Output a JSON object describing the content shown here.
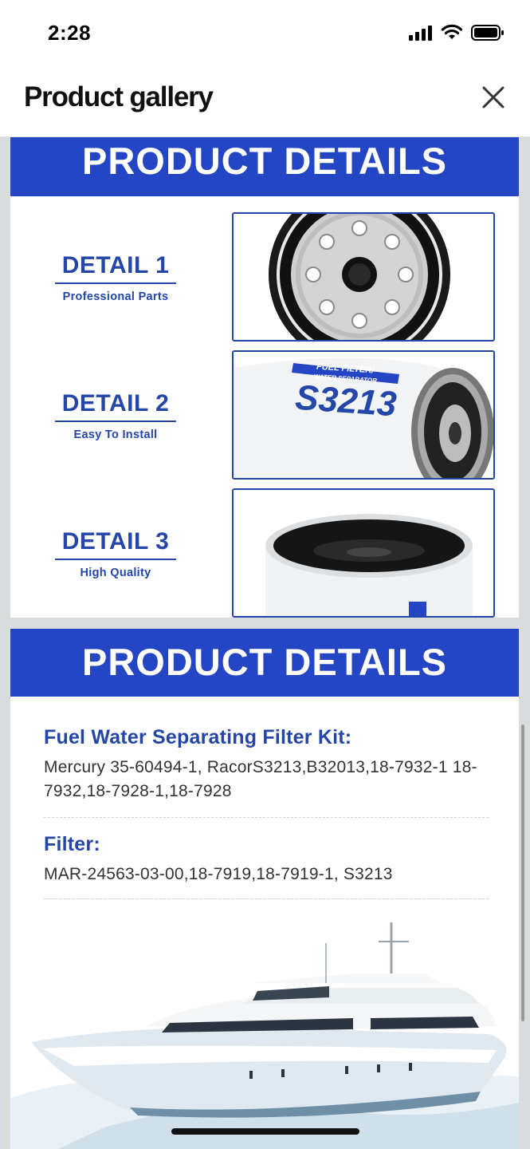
{
  "status_bar": {
    "time": "2:28",
    "icons": [
      "cellular-signal-icon",
      "wifi-icon",
      "battery-icon"
    ]
  },
  "header": {
    "title": "Product gallery",
    "close_icon": "close-icon"
  },
  "gallery": {
    "panel1": {
      "banner": "PRODUCT DETAILS",
      "details": [
        {
          "title": "DETAIL 1",
          "subtitle": "Professional Parts",
          "image": "filter-top-view-image"
        },
        {
          "title": "DETAIL 2",
          "subtitle": "Easy To Install",
          "image": "filter-label-image",
          "label_top": "FUEL FILTER/",
          "label_mid": "WATER SEPARATOR",
          "label_model": "S3213"
        },
        {
          "title": "DETAIL 3",
          "subtitle": "High Quality",
          "image": "filter-base-image"
        }
      ]
    },
    "panel2": {
      "banner": "PRODUCT DETAILS",
      "sections": [
        {
          "heading": "Fuel Water Separating Filter Kit:",
          "body": "Mercury 35-60494-1, RacorS3213,B32013,18-7932-1 18-7932,18-7928-1,18-7928"
        },
        {
          "heading": "Filter:",
          "body": "MAR-24563-03-00,18-7919,18-7919-1, S3213"
        }
      ],
      "image": "yacht-image"
    }
  },
  "colors": {
    "brand_blue": "#2446c4",
    "text_blue": "#2446a8",
    "background_gray": "#d8dcdc"
  }
}
